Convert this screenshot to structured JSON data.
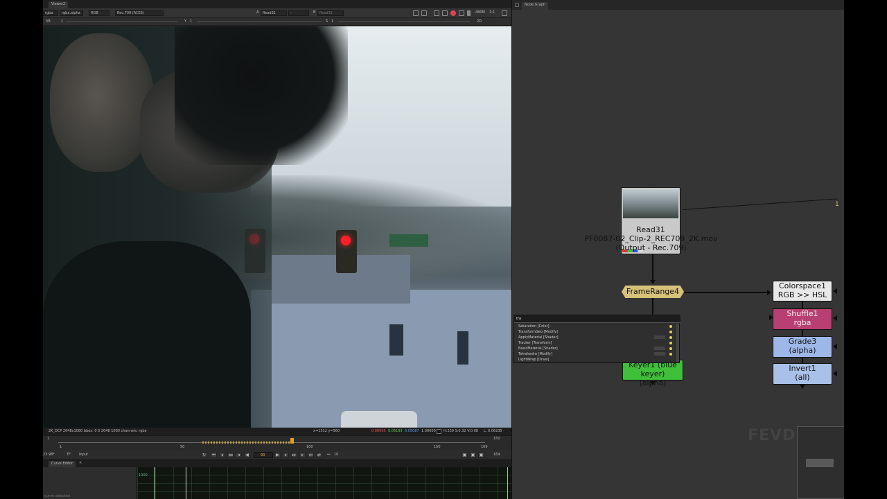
{
  "viewer": {
    "tab": "Viewer2",
    "toolbar": {
      "layer": "rgba",
      "channel": "rgba.alpha",
      "colorspace_mode": "RGB",
      "lut": "Rec.709 (ACES)",
      "input_a_label": "A",
      "input_a": "Read31",
      "blend": "-",
      "input_b_label": "B",
      "input_b": "Read31",
      "zoom": "480M",
      "ratio": "1:1"
    },
    "toolbar2": {
      "fstop": "f/8",
      "gain": "1",
      "y_label": "Y",
      "gamma": "1",
      "s_label": "S",
      "saturation": "1",
      "view_mode": "2D"
    },
    "info": {
      "format": "2K_DCP 2048x1080  bbox: 0 0 2048 1080 channels: rgba",
      "coords": "x=1312 y=560",
      "r": "0.08905",
      "g": "0.06193",
      "b": "0.05087",
      "a": "1.00000",
      "hsv": "H:230 S:0.32 V:0.08",
      "luma": "L: 0.06235"
    },
    "timeline": {
      "start": "1",
      "end": "169",
      "ticks": [
        "50",
        "100",
        "150"
      ],
      "ticks_extra": [
        "169"
      ],
      "fps": "23.98*",
      "tf": "TF",
      "mode": "Input",
      "current_frame": "93",
      "step": "10",
      "end_frame": "169",
      "top_left": "1",
      "top_right": "150"
    }
  },
  "curve_editor": {
    "tab": "Curve Editor",
    "status": "curve selected",
    "value": "1000"
  },
  "node_graph": {
    "tab": "Node Graph",
    "nodes": {
      "read": {
        "name": "Read31",
        "file": "PF0087-02_Clip-2_REC709_2K.mov",
        "colorspace": "(Output - Rec.709)"
      },
      "framerange": {
        "name": "FrameRange4"
      },
      "keyer": {
        "line1": "Keyer1 (blue keyer)",
        "line2": "(alpha)"
      },
      "colorspace": {
        "line1": "Colorspace1",
        "line2": "RGB >> HSL"
      },
      "shuffle": {
        "line1": "Shuffle1",
        "line2": "rgba"
      },
      "grade": {
        "line1": "Grade3",
        "line2": "(alpha)"
      },
      "invert": {
        "line1": "Invert1",
        "line2": "(all)"
      }
    },
    "offscreen_label": "1",
    "tab_menu": {
      "query": "tra",
      "items": [
        "Saturation [Color]",
        "TransformGeo [Modify]",
        "ApplyMaterial [Shader]",
        "Tracker [Transform]",
        "BasicMaterial [Shader]",
        "Tetrahedra [Modify]",
        "LightWrap [Draw]"
      ]
    },
    "watermark": "FEVDINI"
  },
  "colors": {
    "framerange": "#d7c27a",
    "keyer": "#3fbf3a",
    "colorspace": "#e8e8e8",
    "shuffle": "#b83f72",
    "grade": "#9db7e8",
    "invert": "#a9c0e8"
  }
}
